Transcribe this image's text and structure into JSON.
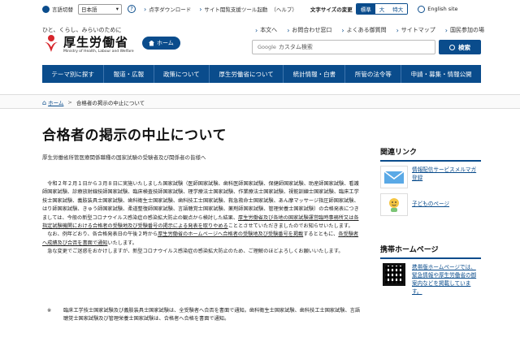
{
  "topbar": {
    "lang_label": "言語切替",
    "lang_value": "日本語",
    "links": [
      "点字ダウンロード",
      "サイト閲覧支援ツール起動"
    ],
    "help": "（ヘルプ）",
    "fontsize_label": "文字サイズの変更",
    "fontsize_options": [
      "標準",
      "大",
      "特大"
    ],
    "english": "English site"
  },
  "header": {
    "tagline": "ひと、くらし、みらいのために",
    "logo_text": "厚生労働省",
    "logo_en": "Ministry of Health, Labour and Welfare",
    "home_label": "ホーム",
    "util_links": [
      "本文へ",
      "お問合わせ窓口",
      "よくある御質問",
      "サイトマップ",
      "国民参加の場"
    ],
    "search_google": "Google",
    "search_placeholder": "カスタム検索",
    "search_button": "検索"
  },
  "nav": {
    "items": [
      "テーマ別に探す",
      "報道・広報",
      "政策について",
      "厚生労働省について",
      "統計情報・白書",
      "所管の法令等",
      "申請・募集・情報公開"
    ]
  },
  "breadcrumb": {
    "home": "ホーム",
    "current": "合格者の掲示の中止について"
  },
  "main": {
    "title": "合格者の掲示の中止について",
    "subtitle": "厚生労働省所管医療関係職種の国家試験の受験者及び関係者の皆様へ",
    "p1_a": "令和２年２月１日から３月８日に実施いたしました国家試験（医師国家試験、歯科医師国家試験、保健師国家試験、助産師国家試験、看護師国家試験、診療放射線技師国家試験、臨床検査技師国家試験、理学療法士国家試験、作業療法士国家試験、視能訓練士国家試験、臨床工学技士国家試験、義肢装具士国家試験、歯科衛生士国家試験、歯科技工士国家試験、救急救命士国家試験、あん摩マッサージ指圧師国家試験、はり師国家試験、きゅう師国家試験、柔道整復師国家試験、言語聴覚士国家試験、薬剤師国家試験、管理栄養士国家試験）の合格発表につきましては、今般の新型コロナウイルス感染症の感染拡大防止の観点から検討した結果、",
    "p1_ul": "厚生労働省及び各地の国家試験運営臨時事務所又は各指定試験機関における合格者の受験地及び受験番号の掲示による発表を取りやめる",
    "p1_b": "こととさせていただきましたのでお知らせいたします。",
    "p2_a": "なお、例年どおり、各合格発表日の午後２時から",
    "p2_ul1": "厚生労働省のホームページへ合格者の受験地及び受験番号を掲載",
    "p2_b": "するとともに、",
    "p2_ul2": "各受験者へ成績及び合否を書面で通知",
    "p2_c": "いたします。",
    "p3": "急な変更でご迷惑をおかけしますが、新型コロナウイルス感染症の感染拡大防止のため、ご理解のほどよろしくお願いいたします。",
    "note_mark": "※",
    "note": "臨床工学技士国家試験及び義肢装具士国家試験は、全受験者へ合否を書面で通知。歯科衛生士国家試験、歯科技工士国家試験、言語聴覚士国家試験及び管理栄養士国家試験は、合格者へ合格を書面で通知。"
  },
  "sidebar": {
    "related_heading": "関連リンク",
    "related_links": [
      "情報配信サービスメルマガ登録",
      "子どものページ"
    ],
    "mobile_heading": "携帯ホームページ",
    "mobile_text": "携帯版ホームページでは、緊急情報や厚生労働省の御案内などを掲載しています。"
  },
  "colors": {
    "brand": "#0a4c8c",
    "logo_red": "#d7262c"
  }
}
